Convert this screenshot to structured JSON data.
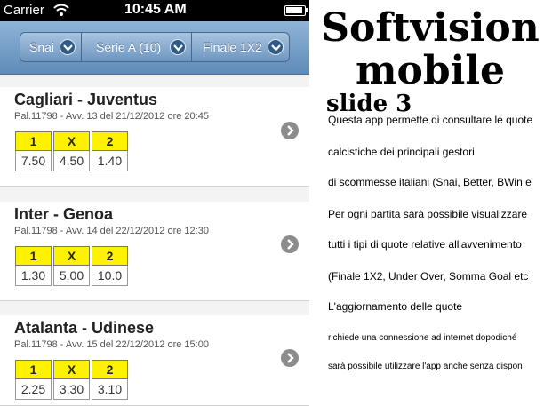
{
  "status_bar": {
    "carrier": "Carrier",
    "time": "10:45 AM"
  },
  "nav": {
    "bookmaker": "Snai",
    "league": "Serie A (10)",
    "market": "Finale 1X2"
  },
  "matches": [
    {
      "teams": "Cagliari - Juventus",
      "info": "Pal.11798 - Avv. 13 del 21/12/2012 ore 20:45",
      "odds": [
        {
          "label": "1",
          "value": "7.50"
        },
        {
          "label": "X",
          "value": "4.50"
        },
        {
          "label": "2",
          "value": "1.40"
        }
      ]
    },
    {
      "teams": "Inter - Genoa",
      "info": "Pal.11798 - Avv. 14 del 22/12/2012 ore 12:30",
      "odds": [
        {
          "label": "1",
          "value": "1.30"
        },
        {
          "label": "X",
          "value": "5.00"
        },
        {
          "label": "2",
          "value": "10.0"
        }
      ]
    },
    {
      "teams": "Atalanta - Udinese",
      "info": "Pal.11798 - Avv. 15 del 22/12/2012 ore 15:00",
      "odds": [
        {
          "label": "1",
          "value": "2.25"
        },
        {
          "label": "X",
          "value": "3.30"
        },
        {
          "label": "2",
          "value": "3.10"
        }
      ]
    }
  ],
  "slide": {
    "title_line1": "Softvision",
    "title_line2": "mobile",
    "subtitle": "slide 3",
    "lines": [
      "Questa app permette di consultare le quote",
      "calcistiche dei principali gestori",
      "di scommesse italiani (Snai, Better, BWin e",
      "Per ogni partita sarà possibile visualizzare",
      "tutti i tipi di quote relative all'avvenimento",
      "(Finale 1X2, Under Over, Somma Goal etc",
      "L'aggiornamento delle quote",
      "richiede una connessione ad internet dopodiché",
      "sarà possibile utilizzare l'app anche senza dispon"
    ]
  },
  "colors": {
    "odds_header": "#fff200",
    "navbar": "#6f96bf",
    "chevron": "#2e5a87"
  }
}
